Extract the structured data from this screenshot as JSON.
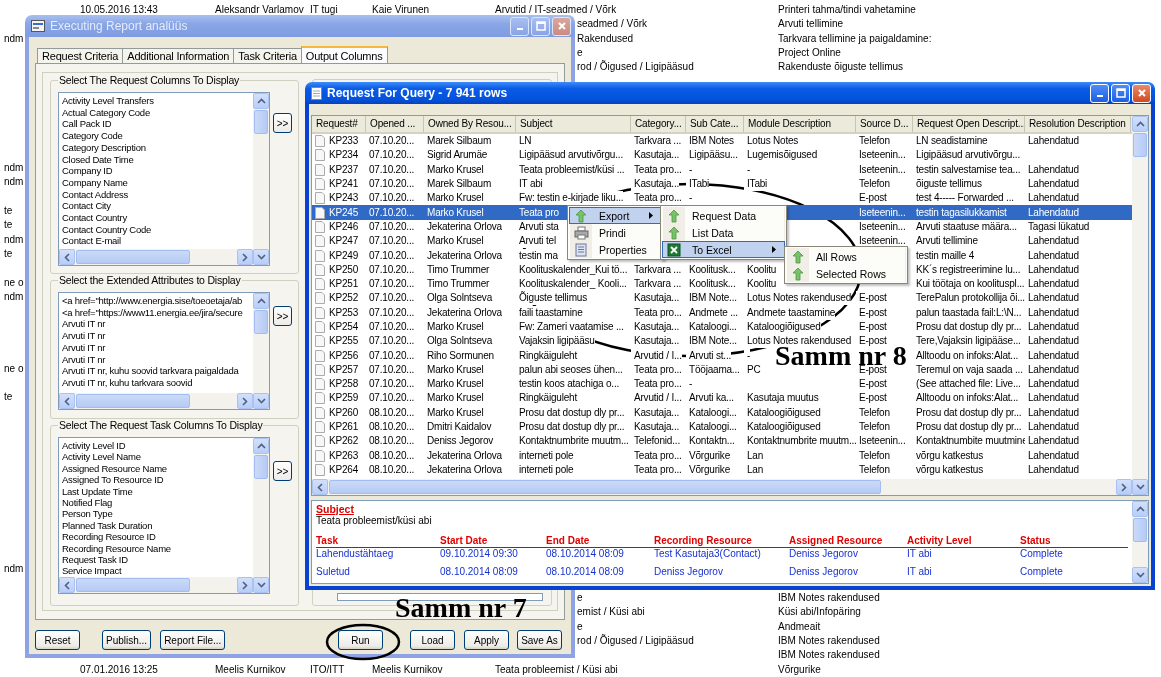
{
  "background_list": {
    "rows": [
      {
        "cells": [
          null,
          "10.05.2016 13:43",
          "Aleksandr Varlamov",
          "IT tugi",
          "Kaie Virunen",
          "Arvutid / IT-seadmed / Võrk",
          null,
          "Printeri tahma/tindi vahetamine"
        ]
      },
      {
        "cells": [
          null,
          null,
          null,
          null,
          null,
          null,
          "seadmed / Võrk",
          "Arvuti tellimine"
        ]
      },
      {
        "cells": [
          "ndm",
          null,
          null,
          null,
          null,
          null,
          "Rakendused",
          "Tarkvara tellimine ja paigaldamine:"
        ]
      },
      {
        "cells": [
          null,
          null,
          null,
          null,
          null,
          null,
          "e",
          "Project Online"
        ]
      },
      {
        "cells": [
          null,
          null,
          null,
          null,
          null,
          null,
          "rod / Õigused / Ligipääsud",
          "Rakenduste õiguste tellimus"
        ]
      },
      {
        "cells": [
          null
        ]
      },
      {
        "cells": [
          null
        ]
      },
      {
        "cells": [
          null
        ]
      },
      {
        "cells": [
          null
        ]
      },
      {
        "cells": [
          null
        ]
      },
      {
        "cells": [
          null
        ]
      },
      {
        "cells": [
          "ndm"
        ]
      },
      {
        "cells": [
          "ndm"
        ]
      },
      {
        "cells": [
          null
        ]
      },
      {
        "cells": [
          "te"
        ]
      },
      {
        "cells": [
          "te"
        ]
      },
      {
        "cells": [
          "ndm"
        ]
      },
      {
        "cells": [
          "te"
        ]
      },
      {
        "cells": [
          null
        ]
      },
      {
        "cells": [
          "ne o"
        ]
      },
      {
        "cells": [
          "ndm"
        ]
      },
      {
        "cells": [
          null
        ]
      },
      {
        "cells": [
          null
        ]
      },
      {
        "cells": [
          null
        ]
      },
      {
        "cells": [
          null
        ]
      },
      {
        "cells": [
          "ne o"
        ]
      },
      {
        "cells": [
          null
        ]
      },
      {
        "cells": [
          "te"
        ]
      },
      {
        "cells": [
          null
        ]
      },
      {
        "cells": [
          null
        ]
      },
      {
        "cells": [
          null
        ]
      },
      {
        "cells": [
          null
        ]
      },
      {
        "cells": [
          null
        ]
      },
      {
        "cells": [
          null
        ]
      },
      {
        "cells": [
          null
        ]
      },
      {
        "cells": [
          null
        ]
      },
      {
        "cells": [
          null
        ]
      },
      {
        "cells": [
          null
        ]
      },
      {
        "cells": [
          null
        ]
      },
      {
        "cells": [
          "ndm"
        ]
      },
      {
        "cells": [
          null
        ]
      },
      {
        "cells": [
          null,
          null,
          null,
          null,
          null,
          null,
          "e",
          "IBM Notes rakendused"
        ]
      },
      {
        "cells": [
          null,
          null,
          null,
          null,
          null,
          null,
          "emist / Küsi abi",
          "Küsi abi/Infopäring"
        ]
      },
      {
        "cells": [
          null,
          null,
          null,
          null,
          null,
          null,
          "e",
          "Andmeait"
        ]
      },
      {
        "cells": [
          null,
          null,
          null,
          null,
          null,
          null,
          "rod / Õigused / Ligipääsud",
          "IBM Notes rakendused"
        ]
      },
      {
        "cells": [
          null,
          null,
          null,
          null,
          null,
          null,
          null,
          "IBM Notes rakendused"
        ]
      },
      {
        "cells": [
          null,
          "07.01.2016 13:25",
          "Meelis Kurnikov",
          "ITO/ITT",
          "Meelis Kurnikov",
          "Teata probleemist / Küsi abi",
          null,
          "Võrgurike"
        ]
      }
    ]
  },
  "report_dialog": {
    "title": "Executing Report analüüs",
    "tabs": [
      {
        "label": "Request Criteria",
        "selected": false
      },
      {
        "label": "Additional Information",
        "selected": false
      },
      {
        "label": "Task Criteria",
        "selected": false
      },
      {
        "label": "Output Columns",
        "selected": true
      }
    ],
    "groups": [
      {
        "title": "Select The Request Columns To Display",
        "add_button": ">>",
        "items": [
          "Activity Level Transfers",
          "Actual Category Code",
          "Call Pack ID",
          "Category Code",
          "Category Description",
          "Closed Date Time",
          "Company ID",
          "Company Name",
          "Contact Address",
          "Contact City",
          "Contact Country",
          "Contact Country Code",
          "Contact E-mail"
        ]
      },
      {
        "title": "Select the Extended Attributes to Display",
        "add_button": ">>",
        "items": [
          "<a href=\"http://www.energia.sise/toeoetaja/ab",
          "<a href=\"https://www11.energia.ee/jira/secure",
          "Arvuti IT nr",
          "Arvuti IT nr",
          "Arvuti IT nr",
          "Arvuti IT nr",
          "Arvuti IT nr, kuhu soovid tarkvara paigaldada",
          "Arvuti IT nr, kuhu tarkvara soovid"
        ]
      },
      {
        "title": "Select The Request Task Columns To Display",
        "add_button": ">>",
        "items": [
          "Activity Level ID",
          "Activity Level Name",
          "Assigned Resource Name",
          "Assigned To Resource ID",
          "Last Update Time",
          "Notified Flag",
          "Person Type",
          "Planned Task Duration",
          "Recording Resource ID",
          "Recording Resource Name",
          "Request Task ID",
          "Service Impact"
        ]
      }
    ],
    "buttons": [
      "Reset",
      "Publish...",
      "Report File...",
      "Run",
      "Load",
      "Apply",
      "Save As"
    ]
  },
  "query_window": {
    "title": "Request For Query - 7 941 rows",
    "table": {
      "columns": [
        "Request#",
        "Opened ...",
        "Owned By Resou...",
        "Subject",
        "Category...",
        "Sub Cate...",
        "Module Description",
        "Source D...",
        "Request Open Descript...",
        "Resolution Description"
      ],
      "rows": [
        {
          "selected": false,
          "cells": [
            "KP233",
            "07.10.20...",
            "Marek Silbaum",
            "LN",
            "Tarkvara ...",
            "IBM Notes",
            "Lotus Notes",
            "Telefon",
            "LN seadistamine",
            "Lahendatud"
          ]
        },
        {
          "selected": false,
          "cells": [
            "KP234",
            "07.10.20...",
            "Sigrid Arumäe",
            "Ligipääsud arvutivõrgu...",
            "Kasutaja...",
            "Ligipääsu...",
            "Lugemisõigused",
            "Iseteenin...",
            "Ligipääsud arvutivõrgu...",
            null
          ]
        },
        {
          "selected": false,
          "cells": [
            "KP237",
            "07.10.20...",
            "Marko Krusel",
            "Teata probleemist/küsi ...",
            "Teata pro...",
            "-",
            "-",
            "Iseteenin...",
            "testin salvestamise tea...",
            "Lahendatud"
          ]
        },
        {
          "selected": false,
          "cells": [
            "KP241",
            "07.10.20...",
            "Marek Silbaum",
            "IT abi",
            "Kasutaja...",
            "ITabi",
            "ITabi",
            "Telefon",
            "õiguste tellimus",
            "Lahendatud"
          ]
        },
        {
          "selected": false,
          "cells": [
            "KP243",
            "07.10.20...",
            "Marko Krusel",
            "Fw: testin e-kirjade liku...",
            "Teata pro...",
            "-",
            null,
            "E-post",
            "test 4----- Forwarded ...",
            "Lahendatud"
          ]
        },
        {
          "selected": true,
          "cells": [
            "KP245",
            "07.10.20...",
            "Marko Krusel",
            "Teata pro",
            null,
            null,
            null,
            "Iseteenin...",
            "testin tagasilukkamist",
            "Lahendatud"
          ]
        },
        {
          "selected": false,
          "cells": [
            "KP246",
            "07.10.20...",
            "Jekaterina Orlova",
            "Arvuti sta",
            null,
            null,
            null,
            "Iseteenin...",
            "Arvuti staatuse määra...",
            "Tagasi lükatud"
          ]
        },
        {
          "selected": false,
          "cells": [
            "KP247",
            "07.10.20...",
            "Marko Krusel",
            "Arvuti tel",
            null,
            null,
            null,
            "Iseteenin...",
            "Arvuti tellimine",
            "Lahendatud"
          ]
        },
        {
          "selected": false,
          "cells": [
            "KP249",
            "07.10.20...",
            "Jekaterina Orlova",
            "testin ma",
            null,
            null,
            null,
            null,
            "testin maille 4",
            "Lahendatud"
          ]
        },
        {
          "selected": false,
          "cells": [
            "KP250",
            "07.10.20...",
            "Timo Trummer",
            "Koolituskalender_Kui tö...",
            "Tarkvara ...",
            "Koolitusk...",
            "Koolitu",
            null,
            "KK´s registreerimine lu...",
            "Lahendatud"
          ]
        },
        {
          "selected": false,
          "cells": [
            "KP251",
            "07.10.20...",
            "Timo Trummer",
            "Koolituskalender_ Kooli...",
            "Tarkvara ...",
            "Koolitusk...",
            "Koolitu",
            null,
            "Kui töötaja on koolituspl...",
            "Lahendatud"
          ]
        },
        {
          "selected": false,
          "cells": [
            "KP252",
            "07.10.20...",
            "Olga Solntseva",
            "Õiguste tellimus",
            "Kasutaja...",
            "IBM Note...",
            "Lotus Notes rakendused",
            "E-post",
            "TerePalun protokollija õi...",
            "Lahendatud"
          ]
        },
        {
          "selected": false,
          "cells": [
            "KP253",
            "07.10.20...",
            "Jekaterina Orlova",
            "faili taastamine",
            "Teata pro...",
            "Andmete ...",
            "Andmete taastamine",
            "E-post",
            "palun taastada fail:L:\\N...",
            "Lahendatud"
          ]
        },
        {
          "selected": false,
          "cells": [
            "KP254",
            "07.10.20...",
            "Marko Krusel",
            "Fw: Zameri vaatamise ...",
            "Kasutaja...",
            "Kataloogi...",
            "Kataloogiõigused",
            "E-post",
            "Prosu dat dostup dly pr...",
            "Lahendatud"
          ]
        },
        {
          "selected": false,
          "cells": [
            "KP255",
            "07.10.20...",
            "Olga Solntseva",
            "Vajaksin ligipääsu",
            "Kasutaja...",
            "IBM Note...",
            "Lotus Notes rakendused",
            "E-post",
            "Tere,Vajaksin ligipääse...",
            "Lahendatud"
          ]
        },
        {
          "selected": false,
          "cells": [
            "KP256",
            "07.10.20...",
            "Riho Sormunen",
            "Ringkäiguleht",
            "Arvutid / I...",
            "Arvuti st...",
            "-",
            null,
            "Alltoodu on infoks:Alat...",
            "Lahendatud"
          ]
        },
        {
          "selected": false,
          "cells": [
            "KP257",
            "07.10.20...",
            "Marko Krusel",
            "palun abi seoses ühen...",
            "Teata pro...",
            "Tööjaama...",
            "PC",
            "E-post",
            "Teremul on vaja saada ...",
            "Lahendatud"
          ]
        },
        {
          "selected": false,
          "cells": [
            "KP258",
            "07.10.20...",
            "Marko Krusel",
            "testin koos atachiga o...",
            "Teata pro...",
            "-",
            null,
            "E-post",
            "(See attached file: Live...",
            "Lahendatud"
          ]
        },
        {
          "selected": false,
          "cells": [
            "KP259",
            "07.10.20...",
            "Marko Krusel",
            "Ringkäiguleht",
            "Arvutid / I...",
            "Arvuti ka...",
            "Kasutaja muutus",
            "E-post",
            "Alltoodu on infoks:Alat...",
            "Lahendatud"
          ]
        },
        {
          "selected": false,
          "cells": [
            "KP260",
            "08.10.20...",
            "Marko Krusel",
            "Prosu dat dostup dly pr...",
            "Kasutaja...",
            "Kataloogi...",
            "Kataloogiõigused",
            "Telefon",
            "Prosu dat dostup dly pr...",
            "Lahendatud"
          ]
        },
        {
          "selected": false,
          "cells": [
            "KP261",
            "08.10.20...",
            "Dmitri Kaidalov",
            "Prosu dat dostup dly pr...",
            "Kasutaja...",
            "Kataloogi...",
            "Kataloogiõigused",
            "Telefon",
            "Prosu dat dostup dly pr...",
            "Lahendatud"
          ]
        },
        {
          "selected": false,
          "cells": [
            "KP262",
            "08.10.20...",
            "Deniss Jegorov",
            "Kontaktnumbrite muutm...",
            "Telefonid...",
            "Kontaktn...",
            "Kontaktnumbrite muutm...",
            "Iseteenin...",
            "Kontaktnumbite muutmine",
            "Lahendatud"
          ]
        },
        {
          "selected": false,
          "cells": [
            "KP263",
            "08.10.20...",
            "Jekaterina Orlova",
            "interneti pole",
            "Teata pro...",
            "Võrgurike",
            "Lan",
            "Telefon",
            "võrgu katkestus",
            "Lahendatud"
          ]
        },
        {
          "selected": false,
          "cells": [
            "KP264",
            "08.10.20...",
            "Jekaterina Orlova",
            "interneti pole",
            "Teata pro...",
            "Võrgurike",
            "Lan",
            "Telefon",
            "võrgu katkestus",
            "Lahendatud"
          ]
        }
      ]
    },
    "context_menu": {
      "items": [
        {
          "label": "Export",
          "highlighted": true,
          "has_submenu": true
        },
        {
          "label": "Prindi",
          "highlighted": false,
          "has_submenu": false
        },
        {
          "label": "Properties",
          "highlighted": false,
          "has_submenu": false
        }
      ]
    },
    "export_submenu": {
      "items": [
        {
          "label": "Request Data",
          "highlighted": false,
          "has_submenu": false
        },
        {
          "label": "List Data",
          "highlighted": false,
          "has_submenu": false
        },
        {
          "label": "To Excel",
          "highlighted": true,
          "has_submenu": true
        }
      ]
    },
    "excel_submenu": {
      "items": [
        {
          "label": "All Rows",
          "highlighted": false,
          "has_submenu": false
        },
        {
          "label": "Selected Rows",
          "highlighted": false,
          "has_submenu": false
        }
      ]
    },
    "details": {
      "subject_label": "Subject",
      "subject": "Teata probleemist/küsi abi",
      "task_columns": [
        "Task",
        "Start Date",
        "End Date",
        "Recording Resource",
        "Assigned Resource",
        "Activity Level",
        "Status"
      ],
      "task_rows": [
        {
          "cells": [
            "Lahendustähtaeg",
            "09.10.2014 09:30",
            "08.10.2014 08:09",
            "Test Kasutaja3(Contact)",
            "Deniss Jegorov",
            "IT abi",
            "Complete"
          ]
        },
        {
          "cells": [
            "Suletud",
            "08.10.2014 08:09",
            "08.10.2014 08:09",
            "Deniss Jegorov",
            "Deniss Jegorov",
            "IT abi",
            "Complete"
          ]
        }
      ]
    }
  },
  "annotations": [
    {
      "text": "Samm nr 8"
    },
    {
      "text": "Samm nr 7"
    }
  ]
}
